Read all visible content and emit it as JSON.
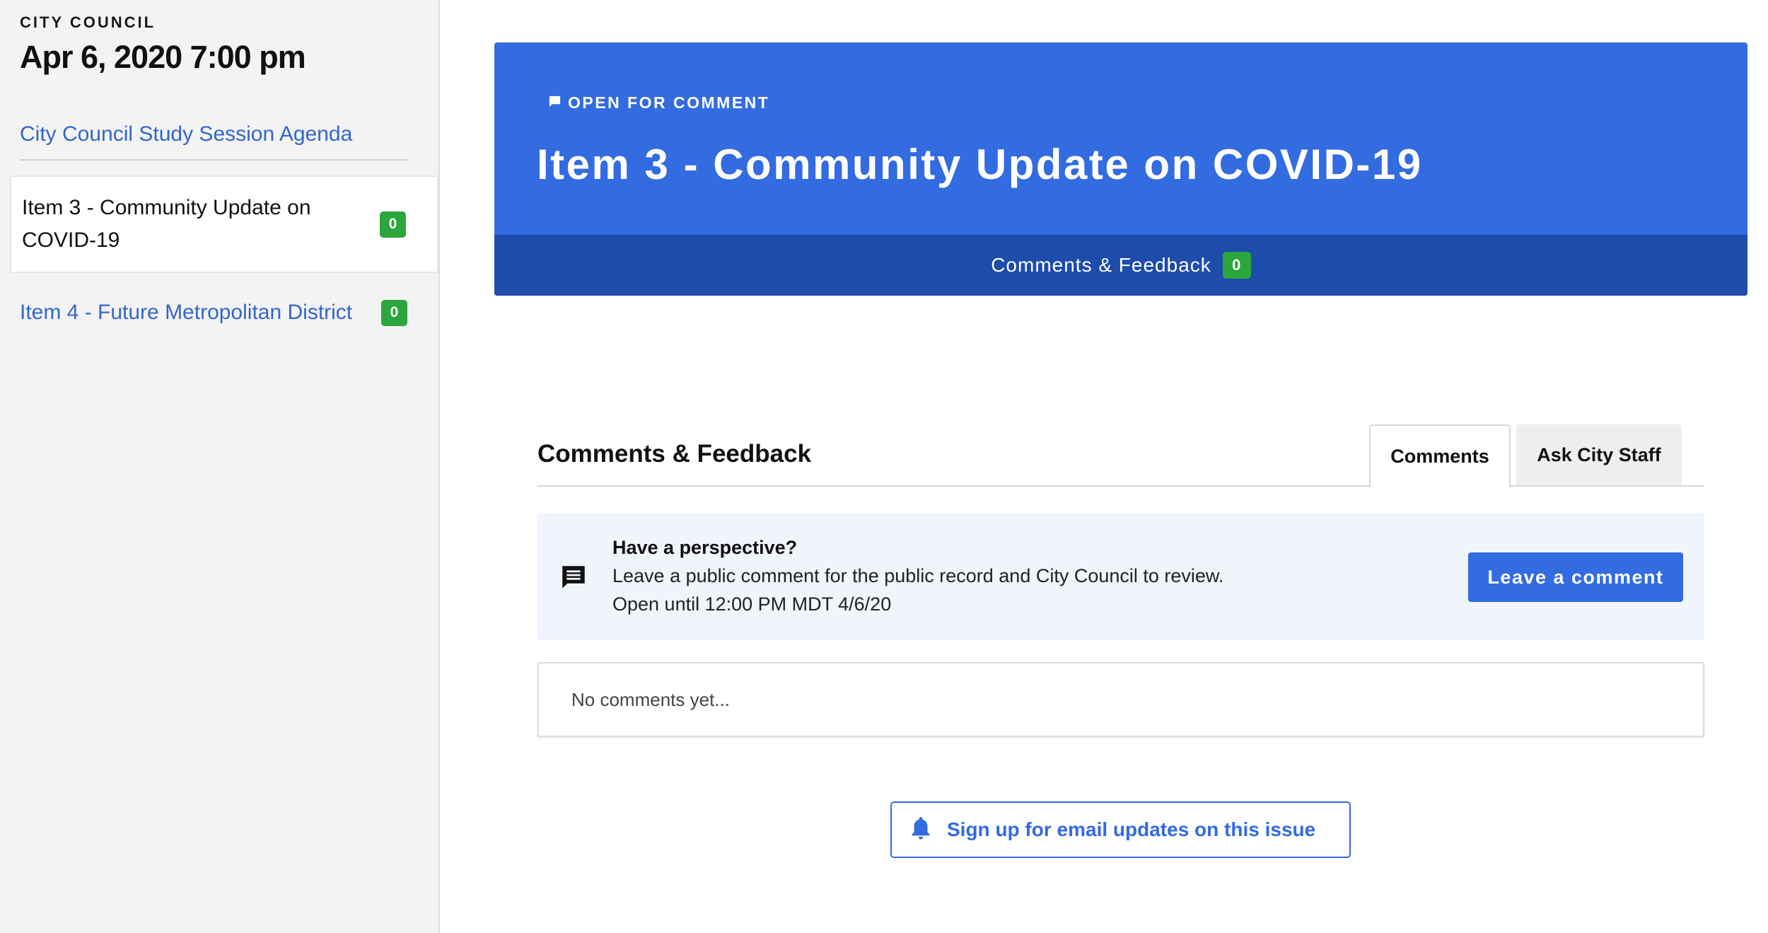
{
  "sidebar": {
    "org_label": "CITY COUNCIL",
    "meeting_date": "Apr 6, 2020 7:00 pm",
    "agenda_link": "City Council Study Session Agenda",
    "items": [
      {
        "label": "Item 3 - Community Update on COVID-19",
        "count": "0",
        "active": true
      },
      {
        "label": "Item 4 - Future Metropolitan District",
        "count": "0",
        "active": false
      }
    ]
  },
  "hero": {
    "status_icon": "flag-icon",
    "status": "OPEN FOR COMMENT",
    "title": "Item 3 - Community Update on COVID-19",
    "tab_label": "Comments & Feedback",
    "tab_count": "0"
  },
  "comments": {
    "section_title": "Comments & Feedback",
    "tabs": [
      {
        "label": "Comments",
        "active": true
      },
      {
        "label": "Ask City Staff",
        "active": false
      }
    ],
    "prompt": {
      "icon": "comment-icon",
      "heading": "Have a perspective?",
      "line1": "Leave a public comment for the public record and City Council to review.",
      "line2": "Open until 12:00 PM MDT 4/6/20",
      "button_label": "Leave a comment"
    },
    "empty_text": "No comments yet...",
    "subscribe": {
      "icon": "bell-icon",
      "label": "Sign up for email updates on this issue"
    }
  },
  "colors": {
    "brand_blue": "#336be0",
    "brand_blue_dark": "#1d4cab",
    "link_blue": "#3366cc",
    "badge_green": "#2aa63c",
    "sidebar_bg": "#f3f3f3",
    "prompt_bg": "#f0f4fb"
  }
}
